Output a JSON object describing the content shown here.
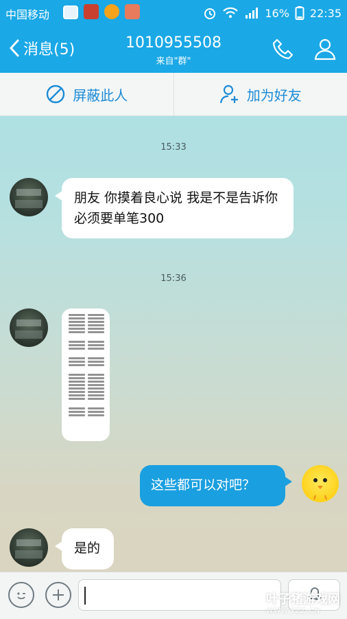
{
  "status": {
    "carrier": "中国移动",
    "battery": "16%",
    "time": "22:35"
  },
  "header": {
    "back_label": "消息(5)",
    "title": "1010955508",
    "subtitle": "来自\"群\""
  },
  "actions": {
    "block_label": "屏蔽此人",
    "add_friend_label": "加为好友"
  },
  "messages": {
    "t1": "15:33",
    "m1": "朋友 你摸着良心说 我是不是告诉你必须要单笔300",
    "t2": "15:36",
    "m3": "这些都可以对吧？",
    "m4": "是的"
  },
  "input": {
    "placeholder": ""
  },
  "watermark": {
    "brand": "叶子猪游戏网",
    "url": "WWW.YZZ.CN"
  }
}
